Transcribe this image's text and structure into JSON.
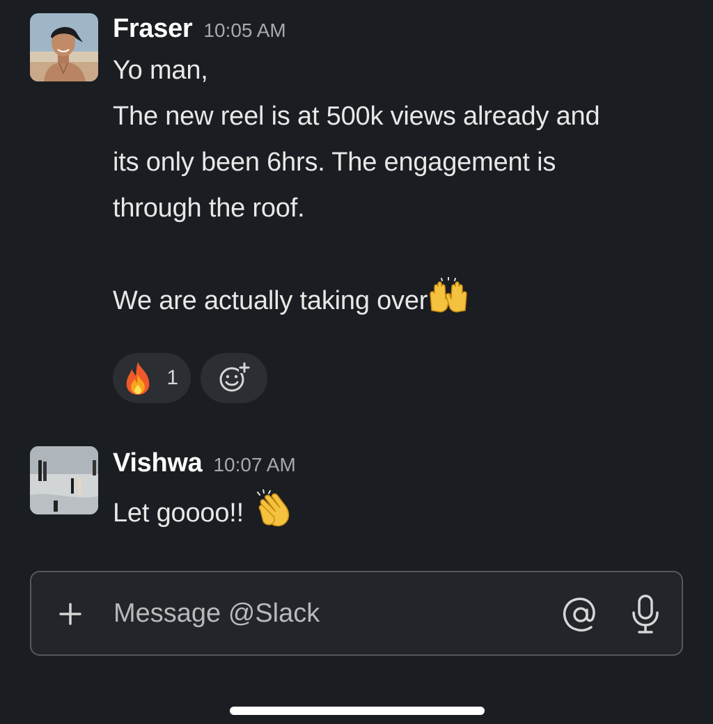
{
  "messages": [
    {
      "sender": "Fraser",
      "time": "10:05 AM",
      "lines": [
        "Yo man,",
        "The new reel is at 500k views already and",
        "its only been 6hrs. The engagement is",
        "through the roof.",
        "",
        "We are actually taking over"
      ],
      "trailing_emoji": "raising-hands-emoji",
      "reactions": [
        {
          "emoji": "fire-emoji",
          "count": "1"
        }
      ],
      "add_reaction_icon": "add-reaction-icon"
    },
    {
      "sender": "Vishwa",
      "time": "10:07 AM",
      "text": "Let goooo!!",
      "trailing_emoji": "clapping-hands-emoji"
    }
  ],
  "composer": {
    "placeholder": "Message @Slack",
    "icons": [
      "plus-icon",
      "at-mention-icon",
      "microphone-icon"
    ]
  },
  "colors": {
    "background": "#1a1d21",
    "reaction_pill": "#2b2e33",
    "composer_border": "#55585e"
  }
}
